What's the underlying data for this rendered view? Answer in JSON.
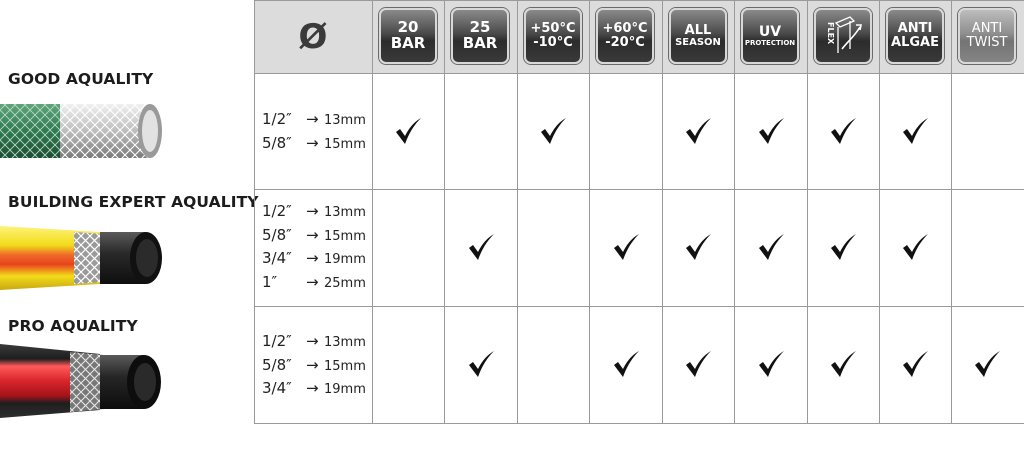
{
  "products": [
    {
      "name": "GOOD AQUALITY",
      "sizes": [
        {
          "inch": "1/2″",
          "mm": "13mm"
        },
        {
          "inch": "5/8″",
          "mm": "15mm"
        }
      ],
      "features": [
        true,
        false,
        true,
        false,
        true,
        true,
        true,
        true,
        false
      ]
    },
    {
      "name": "BUILDING EXPERT AQUALITY",
      "sizes": [
        {
          "inch": "1/2″",
          "mm": "13mm"
        },
        {
          "inch": "5/8″",
          "mm": "15mm"
        },
        {
          "inch": "3/4″",
          "mm": "19mm"
        },
        {
          "inch": "1″",
          "mm": "25mm"
        }
      ],
      "features": [
        false,
        true,
        false,
        true,
        true,
        true,
        true,
        true,
        false
      ]
    },
    {
      "name": "PRO AQUALITY",
      "sizes": [
        {
          "inch": "1/2″",
          "mm": "13mm"
        },
        {
          "inch": "5/8″",
          "mm": "15mm"
        },
        {
          "inch": "3/4″",
          "mm": "19mm"
        }
      ],
      "features": [
        false,
        true,
        false,
        true,
        true,
        true,
        true,
        true,
        true
      ]
    }
  ],
  "header": {
    "diameter_symbol": "Ø",
    "columns": [
      {
        "line1": "20",
        "line2": "BAR"
      },
      {
        "line1": "25",
        "line2": "BAR"
      },
      {
        "line1": "+50°C",
        "line2": "-10°C"
      },
      {
        "line1": "+60°C",
        "line2": "-20°C"
      },
      {
        "line1": "ALL",
        "line2": "SEASON"
      },
      {
        "line1": "UV",
        "line2": "PROTECTION"
      },
      {
        "line1": "FLEX",
        "line2": ""
      },
      {
        "line1": "ANTI",
        "line2": "ALGAE"
      },
      {
        "line1": "ANTI",
        "line2": "TWIST"
      }
    ]
  },
  "arrow_glyph": "→",
  "colors": {
    "header_bg": "#dcdcdc",
    "grid_line": "#9a9a9a",
    "badge_dark": "#2c2c2c",
    "hose_green": "#2f7a52",
    "hose_yellow": "#f2dc1a",
    "hose_orange": "#e8431c",
    "hose_red": "#d8252b",
    "hose_black": "#1e1e1e"
  }
}
